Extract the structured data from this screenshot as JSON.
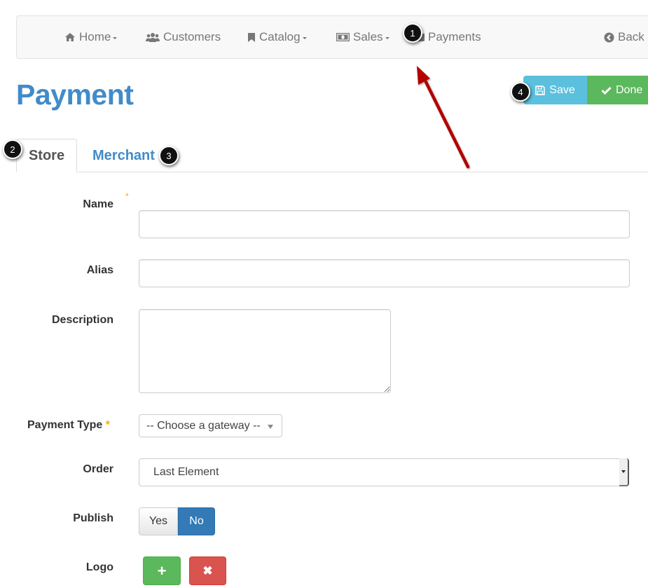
{
  "navbar": {
    "items": [
      {
        "label": "Home",
        "icon": "home-icon",
        "dropdown": true
      },
      {
        "label": "Customers",
        "icon": "users-icon",
        "dropdown": false
      },
      {
        "label": "Catalog",
        "icon": "bookmark-icon",
        "dropdown": true
      },
      {
        "label": "Sales",
        "icon": "money-icon",
        "dropdown": true
      },
      {
        "label": "Payments",
        "icon": "credit-card-icon",
        "dropdown": false
      }
    ],
    "back_label": "Back"
  },
  "page": {
    "title": "Payment"
  },
  "actions": {
    "save_label": "Save",
    "done_label": "Done"
  },
  "tabs": [
    {
      "label": "Store",
      "active": true
    },
    {
      "label": "Merchant",
      "active": false
    }
  ],
  "form": {
    "name": {
      "label": "Name",
      "required": true,
      "value": ""
    },
    "alias": {
      "label": "Alias",
      "value": ""
    },
    "description": {
      "label": "Description",
      "value": ""
    },
    "payment_type": {
      "label": "Payment Type",
      "required": true,
      "selected": "-- Choose a gateway --"
    },
    "order": {
      "label": "Order",
      "selected": "Last Element"
    },
    "publish": {
      "label": "Publish",
      "options": [
        "Yes",
        "No"
      ],
      "selected": "No"
    },
    "logo": {
      "label": "Logo",
      "add_symbol": "+",
      "remove_symbol": "✖"
    }
  },
  "required_marker": "*",
  "callouts": [
    "1",
    "2",
    "3",
    "4"
  ],
  "colors": {
    "primary": "#428bca",
    "info": "#5bc0de",
    "success": "#5cb85c",
    "danger": "#d9534f",
    "toggle_active": "#337ab7",
    "annotation_arrow": "#b30000"
  }
}
